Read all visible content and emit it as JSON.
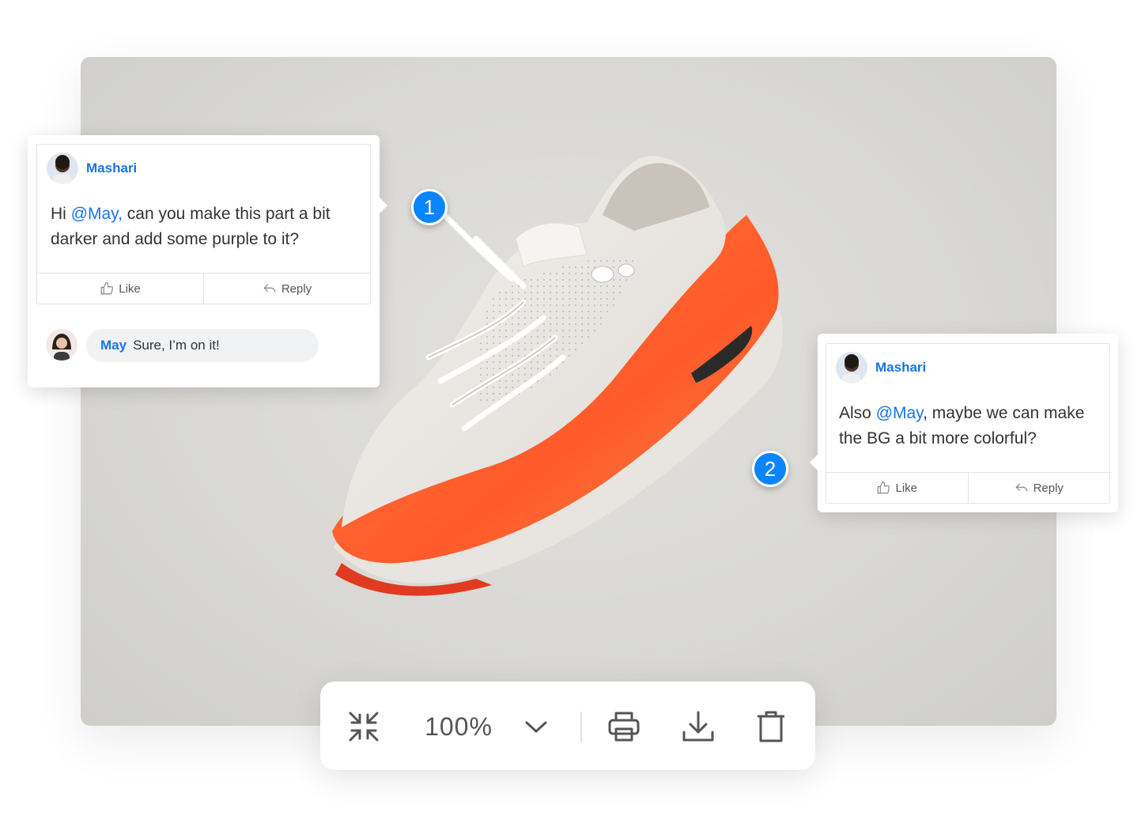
{
  "pins": [
    {
      "number": "1"
    },
    {
      "number": "2"
    }
  ],
  "comment1": {
    "author": "Mashari",
    "text_before": "Hi ",
    "mention": "@May,",
    "text_after": " can you make this part a bit darker and add some purple to it?",
    "like_label": "Like",
    "reply_label": "Reply",
    "reply": {
      "author": "May",
      "text": "Sure, I’m on it!"
    }
  },
  "comment2": {
    "author": "Mashari",
    "text_before": "Also ",
    "mention": "@May",
    "text_after": ", maybe we can make the BG a bit more colorful?",
    "like_label": "Like",
    "reply_label": "Reply"
  },
  "toolbar": {
    "zoom": "100%",
    "icons": [
      "collapse-icon",
      "chevron-down-icon",
      "print-icon",
      "download-icon",
      "trash-icon"
    ]
  },
  "colors": {
    "accent": "#0a84ff",
    "mention": "#1a73e8",
    "sole": "#ff5a2a"
  }
}
